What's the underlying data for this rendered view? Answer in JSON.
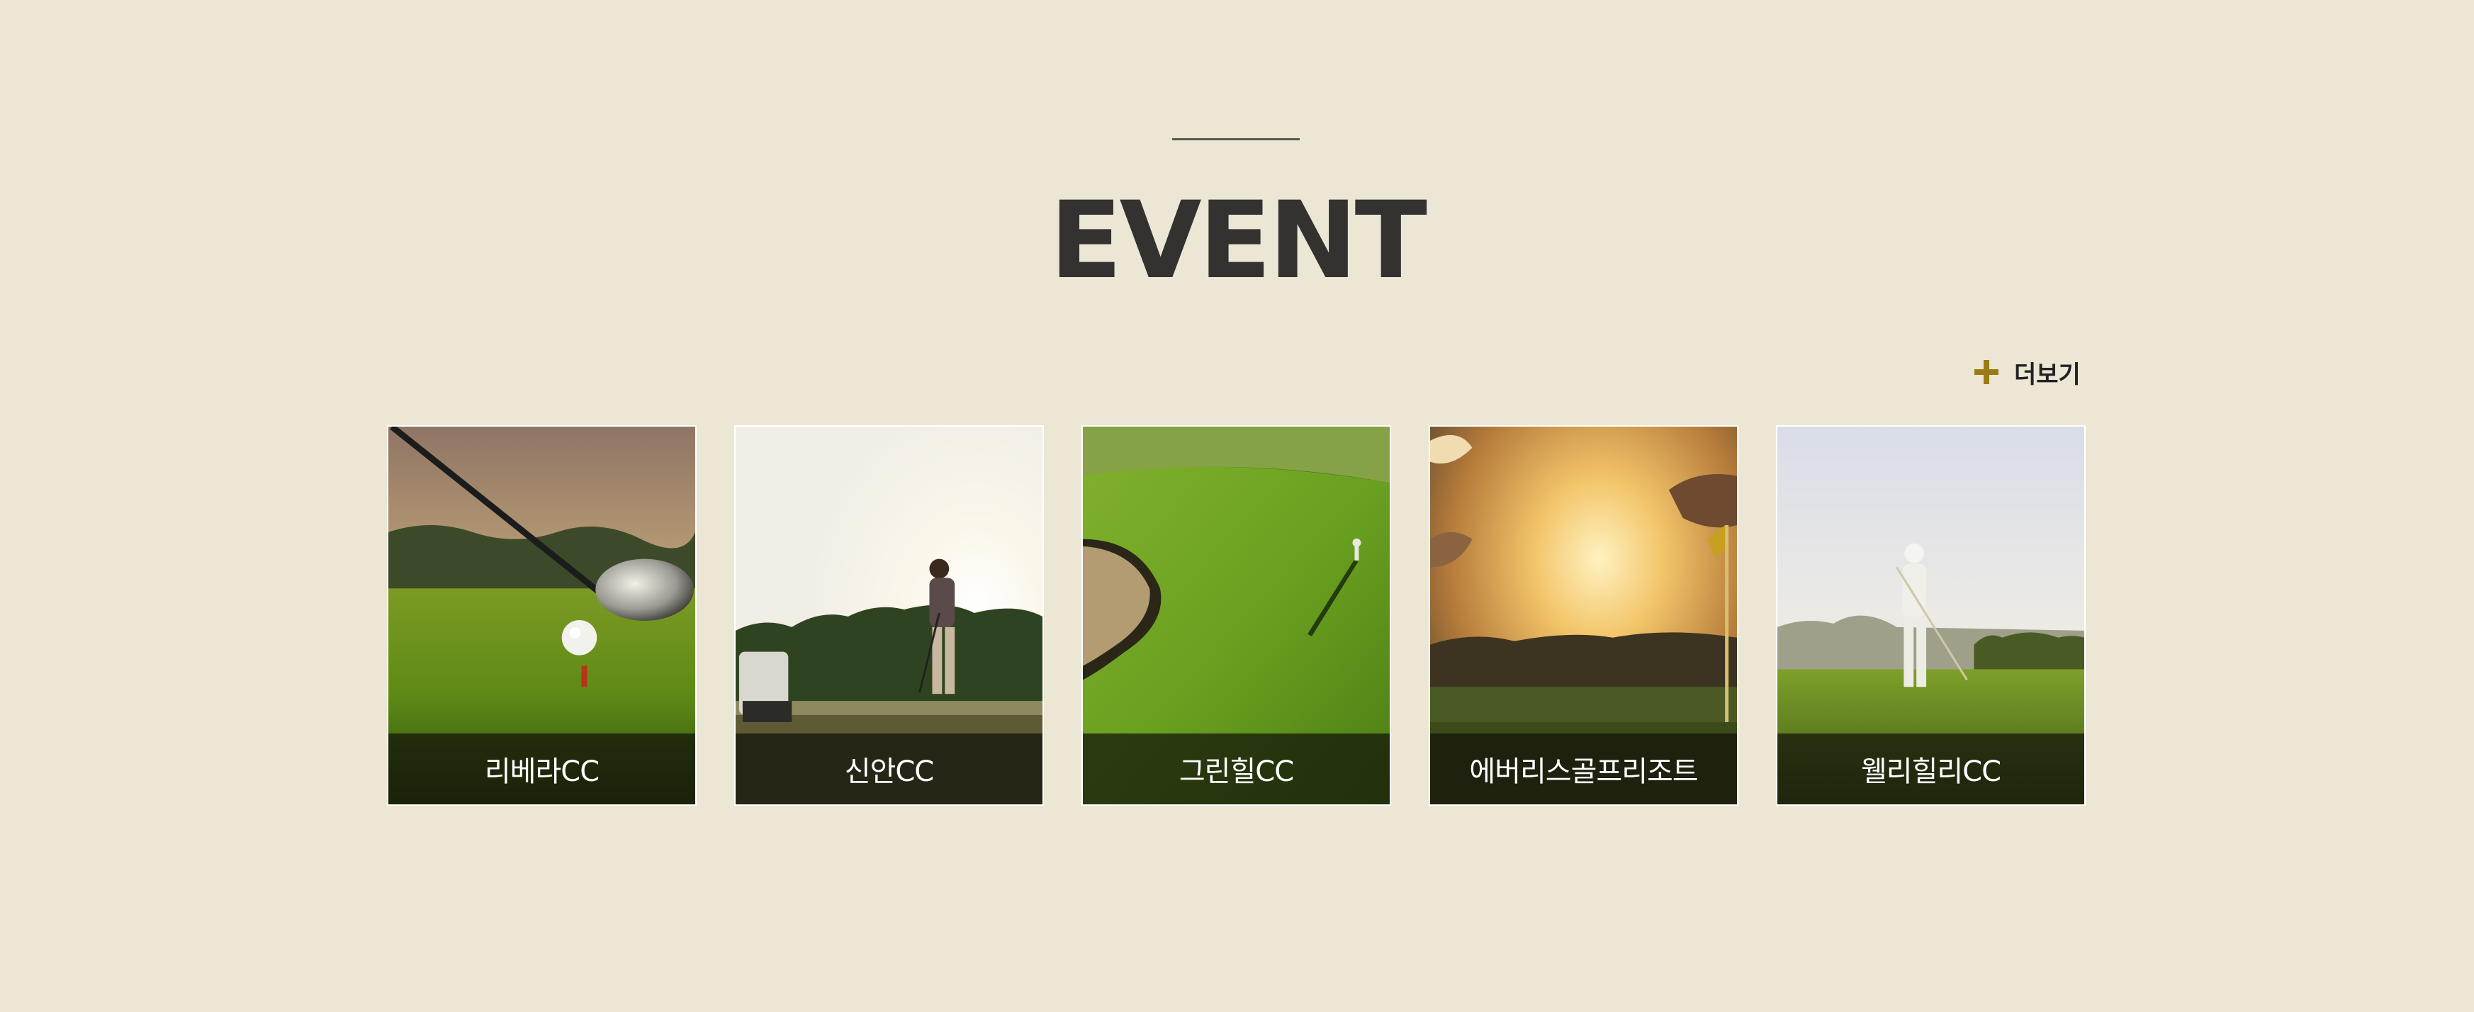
{
  "section": {
    "title": "EVENT",
    "more_label": "더보기",
    "more_icon": "plus-icon",
    "accent_color": "#9a7a14",
    "background_color": "#ece7d5"
  },
  "cards": [
    {
      "label": "리베라CC",
      "image": "golf-driver-and-ball-photo"
    },
    {
      "label": "신안CC",
      "image": "golfer-addressing-ball-photo"
    },
    {
      "label": "그린힐CC",
      "image": "aerial-green-with-golfer-photo"
    },
    {
      "label": "에버리스골프리조트",
      "image": "sunset-course-with-flag-photo"
    },
    {
      "label": "웰리힐리CC",
      "image": "golfer-follow-through-photo"
    }
  ]
}
